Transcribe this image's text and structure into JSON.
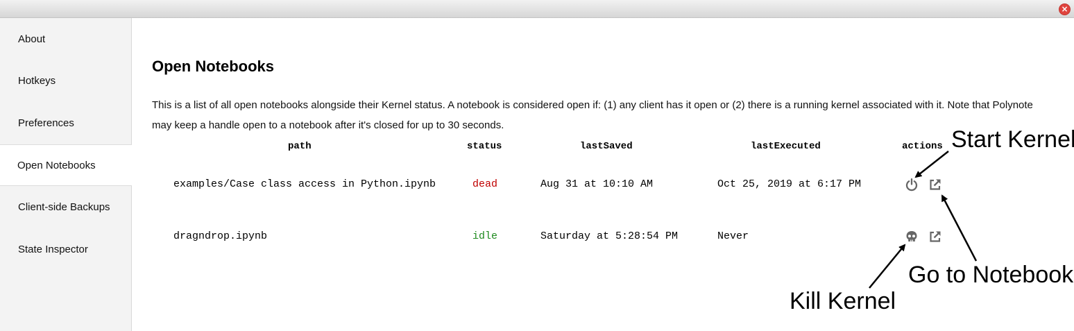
{
  "sidebar": {
    "items": [
      {
        "label": "About"
      },
      {
        "label": "Hotkeys"
      },
      {
        "label": "Preferences"
      },
      {
        "label": "Open Notebooks"
      },
      {
        "label": "Client-side Backups"
      },
      {
        "label": "State Inspector"
      }
    ],
    "active": "Open Notebooks"
  },
  "main": {
    "title": "Open Notebooks",
    "description": "This is a list of all open notebooks alongside their Kernel status. A notebook is considered open if: (1) any client has it open or (2) there is a running kernel associated with it. Note that Polynote may keep a handle open to a notebook after it's closed for up to 30 seconds.",
    "table": {
      "headers": {
        "path": "path",
        "status": "status",
        "lastSaved": "lastSaved",
        "lastExecuted": "lastExecuted",
        "actions": "actions"
      },
      "rows": [
        {
          "path": "examples/Case class access in Python.ipynb",
          "status": "dead",
          "lastSaved": "Aug 31 at 10:10 AM",
          "lastExecuted": "Oct 25, 2019 at 6:17 PM",
          "kernel_action_icon": "power-icon",
          "open_action_icon": "external-link-icon"
        },
        {
          "path": "dragndrop.ipynb",
          "status": "idle",
          "lastSaved": "Saturday at 5:28:54 PM",
          "lastExecuted": "Never",
          "kernel_action_icon": "skull-icon",
          "open_action_icon": "external-link-icon"
        }
      ]
    }
  },
  "annotations": {
    "start_kernel": "Start Kernel",
    "go_to_notebook": "Go to Notebook",
    "kill_kernel": "Kill Kernel"
  },
  "colors": {
    "status_dead": "#c00000",
    "status_idle": "#1e8a1e",
    "icon": "#666666",
    "close_button": "#e0443e"
  }
}
